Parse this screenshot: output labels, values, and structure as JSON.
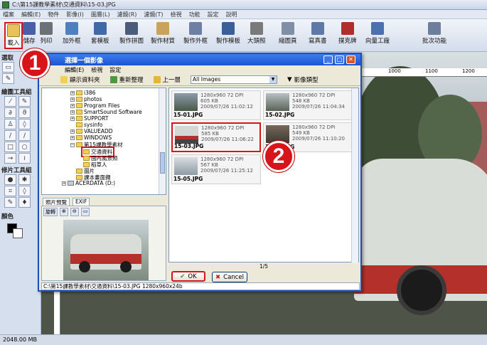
{
  "window": {
    "title": "C:\\第15課教學素材\\交通資料\\15-03.JPG"
  },
  "menu": [
    "檔案",
    "編輯(E)",
    "物件",
    "影像(I)",
    "圖層(L)",
    "濾鏡(R)",
    "濾鏡(T)",
    "檢視",
    "功能",
    "設定",
    "說明"
  ],
  "toolbar": {
    "buttons": [
      {
        "label": "載入",
        "icon": "open-folder-icon"
      },
      {
        "label": "儲存",
        "icon": "save-icon"
      },
      {
        "label": "列印",
        "icon": "print-icon"
      },
      {
        "label": "加外框",
        "icon": "frame-icon"
      },
      {
        "label": "套模板",
        "icon": "template-icon"
      },
      {
        "label": "製作拼圖",
        "icon": "puzzle-icon"
      },
      {
        "label": "製作材質",
        "icon": "texture-icon"
      },
      {
        "label": "製作外框",
        "icon": "make-frame-icon"
      },
      {
        "label": "製作模板",
        "icon": "make-template-icon"
      },
      {
        "label": "大頭照",
        "icon": "id-photo-icon"
      },
      {
        "label": "縮圖頁",
        "icon": "thumbnail-page-icon"
      },
      {
        "label": "寫真書",
        "icon": "photo-book-icon"
      },
      {
        "label": "撲克牌",
        "icon": "poker-icon"
      },
      {
        "label": "向量工廠",
        "icon": "vector-icon"
      },
      {
        "label": "批次功能",
        "icon": "batch-icon"
      }
    ]
  },
  "left_panel": {
    "select_label": "選取",
    "draw_tools_label": "繪圖工具組",
    "retouch_tools_label": "修片工具組",
    "color_label": "顏色"
  },
  "ruler": {
    "marks": [
      "1000",
      "1100",
      "1200"
    ]
  },
  "status": {
    "memory": "2048.00 MB"
  },
  "dialog": {
    "title": "選擇一個影像",
    "menu": [
      "編輯(E)",
      "檢視",
      "設定"
    ],
    "tools": {
      "show_folders": "顯示資料夾",
      "refresh": "重新整理",
      "up": "上一層",
      "filter_value": "All Images",
      "filter_label": "影像類型"
    },
    "tree": [
      {
        "label": "i386",
        "level": 3
      },
      {
        "label": "photos",
        "level": 3
      },
      {
        "label": "Program Files",
        "level": 3
      },
      {
        "label": "SmartSound Software",
        "level": 3
      },
      {
        "label": "SUPPORT",
        "level": 3
      },
      {
        "label": "sysinfo",
        "level": 3
      },
      {
        "label": "VALUEADD",
        "level": 3
      },
      {
        "label": "WINDOWS",
        "level": 3
      },
      {
        "label": "第15課教學素材",
        "level": 3
      },
      {
        "label": "交通資料",
        "level": 4
      },
      {
        "label": "國內風景照",
        "level": 4
      },
      {
        "label": "稻草人",
        "level": 4
      },
      {
        "label": "圖片",
        "level": 3
      },
      {
        "label": "課本畫面擷",
        "level": 3
      },
      {
        "label": "ACERDATA (D:)",
        "level": 2
      }
    ],
    "preview_tabs": [
      "照片預覽",
      "EXIF"
    ],
    "preview_tools": [
      "旋轉",
      "⊕",
      "⊖",
      "▭"
    ],
    "thumbnails": [
      {
        "filename": "15-01.JPG",
        "res": "1280x960 72 DPI",
        "size": "605 KB",
        "date": "2009/07/26 11:02:12"
      },
      {
        "filename": "15-02.JPG",
        "res": "1280x960 72 DPI",
        "size": "548 KB",
        "date": "2009/07/26 11:04:34"
      },
      {
        "filename": "15-03.JPG",
        "res": "1280x960 72 DPI",
        "size": "585 KB",
        "date": "2009/07/26 11:06:22"
      },
      {
        "filename": "15-04.JPG",
        "res": "1280x960 72 DPI",
        "size": "549 KB",
        "date": "2009/07/26 11:10:20"
      },
      {
        "filename": "15-05.JPG",
        "res": "1280x960 72 DPI",
        "size": "567 KB",
        "date": "2009/07/26 11:25:12"
      }
    ],
    "pager": "1/5",
    "ok_label": "OK",
    "cancel_label": "Cancel",
    "path": "C:\\第15課教學素材\\交通資料\\15-03.JPG   1280x960x24b"
  },
  "badges": {
    "step1": "1",
    "step2": "2"
  },
  "colors": {
    "accent_red": "#d8141b",
    "title_blue": "#1b55d0"
  }
}
